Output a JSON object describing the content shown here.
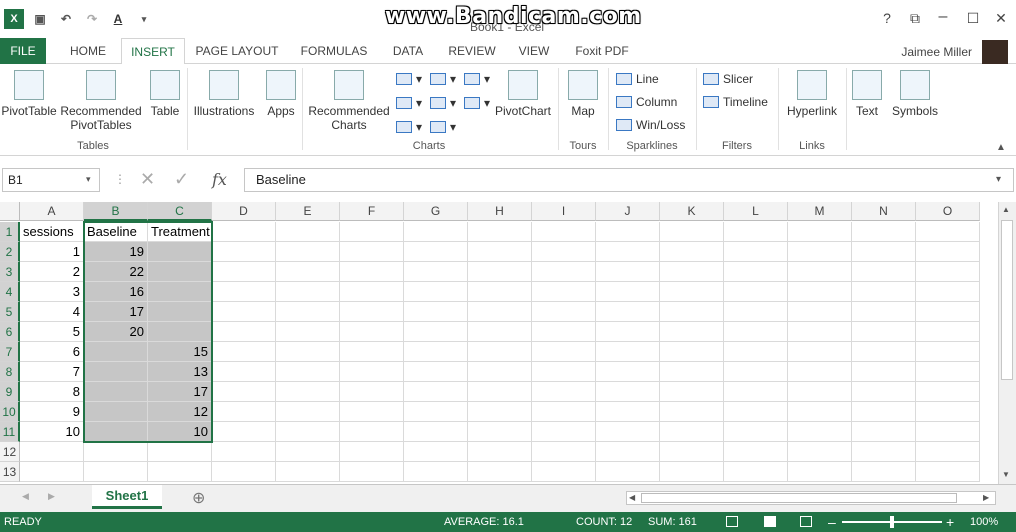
{
  "titlebar": {
    "doc_title": "Book1 - Excel",
    "watermark": "www.Bandicam.com",
    "help": "?",
    "restore": "⧉",
    "maximize": "☐",
    "close": "✕"
  },
  "tabs": [
    {
      "label": "FILE"
    },
    {
      "label": "HOME"
    },
    {
      "label": "INSERT"
    },
    {
      "label": "PAGE LAYOUT"
    },
    {
      "label": "FORMULAS"
    },
    {
      "label": "DATA"
    },
    {
      "label": "REVIEW"
    },
    {
      "label": "VIEW"
    },
    {
      "label": "Foxit PDF"
    }
  ],
  "user": "Jaimee Miller",
  "ribbon": {
    "pivottable": "PivotTable",
    "recommended_pivot": "Recommended PivotTables",
    "table": "Table",
    "illustrations": "Illustrations",
    "apps": "Apps",
    "recommended_charts": "Recommended Charts",
    "pivotchart": "PivotChart",
    "map": "Map",
    "line": "Line",
    "column": "Column",
    "winloss": "Win/Loss",
    "slicer": "Slicer",
    "timeline": "Timeline",
    "hyperlink": "Hyperlink",
    "text": "Text",
    "symbols": "Symbols",
    "groups": {
      "tables": "Tables",
      "charts": "Charts",
      "tours": "Tours",
      "sparklines": "Sparklines",
      "filters": "Filters",
      "links": "Links"
    }
  },
  "formula_bar": {
    "name_box": "B1",
    "fx": "fx",
    "content": "Baseline"
  },
  "columns": [
    "A",
    "B",
    "C",
    "D",
    "E",
    "F",
    "G",
    "H",
    "I",
    "J",
    "K",
    "L",
    "M",
    "N",
    "O"
  ],
  "rows": [
    {
      "n": "1",
      "a": "sessions",
      "b": "Baseline",
      "c": "Treatment"
    },
    {
      "n": "2",
      "a": "1",
      "b": "19",
      "c": ""
    },
    {
      "n": "3",
      "a": "2",
      "b": "22",
      "c": ""
    },
    {
      "n": "4",
      "a": "3",
      "b": "16",
      "c": ""
    },
    {
      "n": "5",
      "a": "4",
      "b": "17",
      "c": ""
    },
    {
      "n": "6",
      "a": "5",
      "b": "20",
      "c": ""
    },
    {
      "n": "7",
      "a": "6",
      "b": "",
      "c": "15"
    },
    {
      "n": "8",
      "a": "7",
      "b": "",
      "c": "13"
    },
    {
      "n": "9",
      "a": "8",
      "b": "",
      "c": "17"
    },
    {
      "n": "10",
      "a": "9",
      "b": "",
      "c": "12"
    },
    {
      "n": "11",
      "a": "10",
      "b": "",
      "c": "10"
    },
    {
      "n": "12",
      "a": "",
      "b": "",
      "c": ""
    },
    {
      "n": "13",
      "a": "",
      "b": "",
      "c": ""
    }
  ],
  "sheet": {
    "tab": "Sheet1",
    "add": "⊕"
  },
  "status": {
    "mode": "READY",
    "average": "AVERAGE: 16.1",
    "count": "COUNT: 12",
    "sum": "SUM: 161",
    "zoom": "100%"
  }
}
